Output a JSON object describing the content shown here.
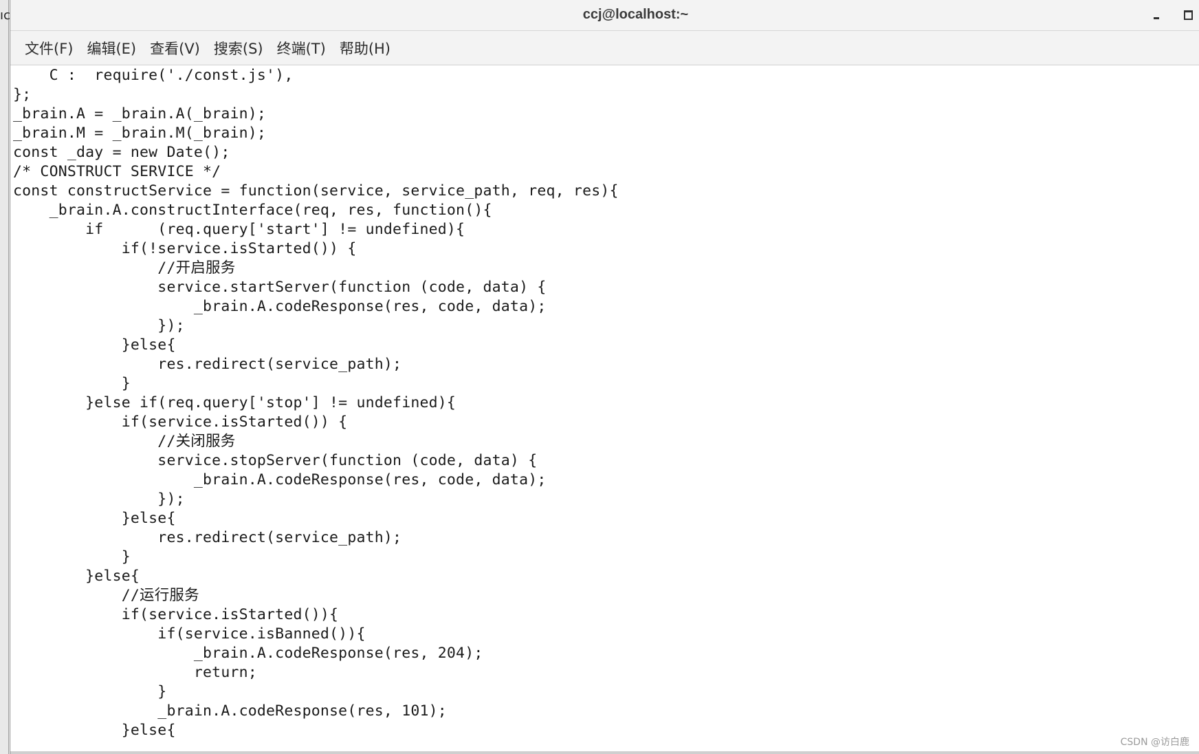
{
  "left_fragment": "ıc",
  "window": {
    "title": "ccj@localhost:~",
    "minimize_icon": "minimize-icon",
    "maximize_icon": "maximize-icon"
  },
  "menu": [
    "文件(F)",
    "编辑(E)",
    "查看(V)",
    "搜索(S)",
    "终端(T)",
    "帮助(H)"
  ],
  "code_lines": [
    "    C :  require('./const.js'),",
    "};",
    "_brain.A = _brain.A(_brain);",
    "_brain.M = _brain.M(_brain);",
    "const _day = new Date();",
    "/* CONSTRUCT SERVICE */",
    "const constructService = function(service, service_path, req, res){",
    "    _brain.A.constructInterface(req, res, function(){",
    "        if      (req.query['start'] != undefined){",
    "            if(!service.isStarted()) {",
    "                //开启服务",
    "                service.startServer(function (code, data) {",
    "                    _brain.A.codeResponse(res, code, data);",
    "                });",
    "            }else{",
    "                res.redirect(service_path);",
    "            }",
    "        }else if(req.query['stop'] != undefined){",
    "            if(service.isStarted()) {",
    "                //关闭服务",
    "                service.stopServer(function (code, data) {",
    "                    _brain.A.codeResponse(res, code, data);",
    "                });",
    "            }else{",
    "                res.redirect(service_path);",
    "            }",
    "        }else{",
    "            //运行服务",
    "            if(service.isStarted()){",
    "                if(service.isBanned()){",
    "                    _brain.A.codeResponse(res, 204);",
    "                    return;",
    "                }",
    "                _brain.A.codeResponse(res, 101);",
    "            }else{"
  ],
  "watermark": "CSDN @访白鹿"
}
